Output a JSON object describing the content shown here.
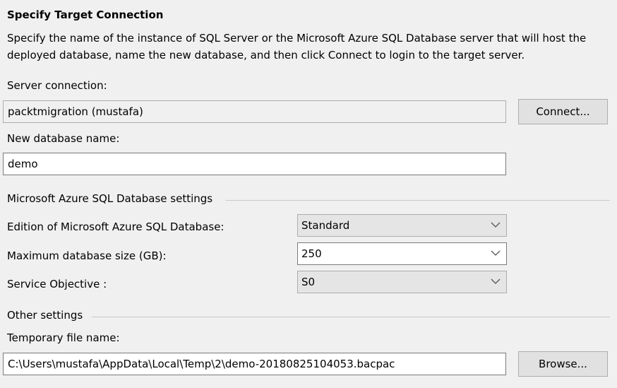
{
  "header": {
    "title": "Specify Target Connection",
    "description": "Specify the name of the instance of SQL Server or the Microsoft Azure SQL Database server that will host the deployed database, name the new database, and then click Connect to login to the target server."
  },
  "server": {
    "label": "Server connection:",
    "value": "packtmigration (mustafa)",
    "connect_label": "Connect..."
  },
  "database": {
    "label": "New database name:",
    "value": "demo"
  },
  "azure": {
    "group_label": "Microsoft Azure SQL Database settings",
    "edition_label": "Edition of Microsoft Azure SQL Database:",
    "edition_value": "Standard",
    "size_label": "Maximum database size (GB):",
    "size_value": "250",
    "objective_label": "Service Objective :",
    "objective_value": "S0"
  },
  "other": {
    "group_label": "Other settings",
    "temp_label": "Temporary file name:",
    "temp_value": "C:\\Users\\mustafa\\AppData\\Local\\Temp\\2\\demo-20180825104053.bacpac",
    "browse_label": "Browse..."
  },
  "colors": {
    "background": "#f0f0f0",
    "button": "#e1e1e1",
    "field_border": "#7a7a7a"
  }
}
